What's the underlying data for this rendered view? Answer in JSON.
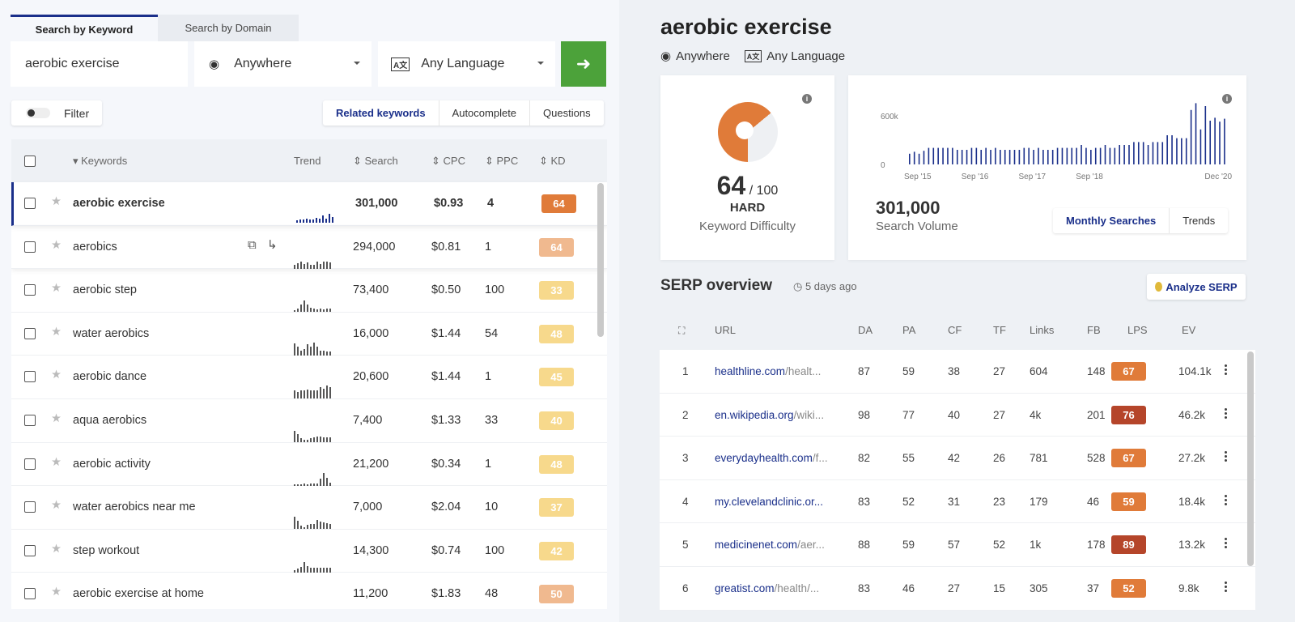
{
  "search": {
    "tabs": [
      "Search by Keyword",
      "Search by Domain"
    ],
    "keyword": "aerobic exercise",
    "location": "Anywhere",
    "language": "Any Language",
    "go_icon": "arrow-right-icon"
  },
  "filter": {
    "label": "Filter"
  },
  "modes": [
    "Related keywords",
    "Autocomplete",
    "Questions"
  ],
  "keywords_table": {
    "headers": {
      "keywords": "Keywords",
      "trend": "Trend",
      "search": "Search",
      "cpc": "CPC",
      "ppc": "PPC",
      "kd": "KD"
    },
    "rows": [
      {
        "keyword": "aerobic exercise",
        "search": "301,000",
        "cpc": "$0.93",
        "ppc": "4",
        "kd": "64",
        "kd_color": "#e07b39",
        "trend": [
          3,
          4,
          4,
          5,
          4,
          4,
          6,
          5,
          9,
          5,
          11,
          7
        ]
      },
      {
        "keyword": "aerobics",
        "search": "294,000",
        "cpc": "$0.81",
        "ppc": "1",
        "kd": "64",
        "kd_color": "#f0b98f",
        "trend": [
          5,
          7,
          9,
          6,
          8,
          5,
          5,
          9,
          6,
          9,
          9,
          8
        ]
      },
      {
        "keyword": "aerobic step",
        "search": "73,400",
        "cpc": "$0.50",
        "ppc": "100",
        "kd": "33",
        "kd_color": "#f7d98c",
        "trend": [
          2,
          4,
          9,
          14,
          9,
          5,
          4,
          3,
          4,
          3,
          4,
          4
        ]
      },
      {
        "keyword": "water aerobics",
        "search": "16,000",
        "cpc": "$1.44",
        "ppc": "54",
        "kd": "48",
        "kd_color": "#f7d98c",
        "trend": [
          15,
          11,
          6,
          8,
          14,
          11,
          16,
          11,
          6,
          6,
          5,
          5
        ]
      },
      {
        "keyword": "aerobic dance",
        "search": "20,600",
        "cpc": "$1.44",
        "ppc": "1",
        "kd": "45",
        "kd_color": "#f7d98c",
        "trend": [
          10,
          8,
          10,
          10,
          11,
          10,
          10,
          10,
          14,
          12,
          16,
          14
        ]
      },
      {
        "keyword": "aqua aerobics",
        "search": "7,400",
        "cpc": "$1.33",
        "ppc": "33",
        "kd": "40",
        "kd_color": "#f7d98c",
        "trend": [
          14,
          10,
          5,
          3,
          3,
          5,
          6,
          7,
          7,
          6,
          6,
          6
        ]
      },
      {
        "keyword": "aerobic activity",
        "search": "21,200",
        "cpc": "$0.34",
        "ppc": "1",
        "kd": "48",
        "kd_color": "#f7d98c",
        "trend": [
          2,
          2,
          2,
          3,
          2,
          3,
          3,
          3,
          9,
          16,
          10,
          4
        ]
      },
      {
        "keyword": "water aerobics near me",
        "search": "7,000",
        "cpc": "$2.04",
        "ppc": "10",
        "kd": "37",
        "kd_color": "#f7d98c",
        "trend": [
          15,
          10,
          4,
          2,
          5,
          6,
          6,
          11,
          9,
          8,
          7,
          6
        ]
      },
      {
        "keyword": "step workout",
        "search": "14,300",
        "cpc": "$0.74",
        "ppc": "100",
        "kd": "42",
        "kd_color": "#f7d98c",
        "trend": [
          3,
          5,
          7,
          13,
          8,
          6,
          6,
          6,
          6,
          6,
          6,
          6
        ]
      },
      {
        "keyword": "aerobic exercise at home",
        "search": "11,200",
        "cpc": "$1.83",
        "ppc": "48",
        "kd": "50",
        "kd_color": "#f0b98f",
        "trend": [
          1,
          1,
          2,
          1,
          3,
          1,
          2,
          1,
          2,
          3,
          1,
          2
        ]
      }
    ]
  },
  "detail": {
    "title": "aerobic exercise",
    "location": "Anywhere",
    "language": "Any Language",
    "kd": {
      "value": "64",
      "max": "/ 100",
      "level": "HARD",
      "label": "Keyword Difficulty",
      "fraction": 0.64,
      "color": "#e07b39"
    },
    "volume": {
      "value": "301,000",
      "label": "Search Volume",
      "tabs": [
        "Monthly Searches",
        "Trends"
      ]
    }
  },
  "chart_data": {
    "type": "bar",
    "ylim": [
      0,
      600000
    ],
    "yticks": [
      "0",
      "600k"
    ],
    "xticks": [
      "Sep '15",
      "Sep '16",
      "Sep '17",
      "Sep '18",
      "Dec '20"
    ],
    "grid": false,
    "color": "#1a2f8a",
    "values": [
      110000,
      130000,
      110000,
      140000,
      170000,
      170000,
      170000,
      170000,
      170000,
      170000,
      150000,
      150000,
      150000,
      170000,
      170000,
      150000,
      170000,
      150000,
      170000,
      150000,
      150000,
      150000,
      150000,
      150000,
      170000,
      170000,
      150000,
      170000,
      150000,
      150000,
      150000,
      170000,
      170000,
      170000,
      170000,
      170000,
      200000,
      170000,
      150000,
      170000,
      170000,
      200000,
      170000,
      170000,
      200000,
      200000,
      200000,
      230000,
      230000,
      230000,
      200000,
      230000,
      230000,
      230000,
      300000,
      300000,
      270000,
      270000,
      270000,
      560000,
      630000,
      360000,
      600000,
      450000,
      480000,
      440000,
      470000
    ]
  },
  "serp": {
    "title": "SERP overview",
    "updated": "5 days ago",
    "analyze_label": "Analyze SERP",
    "headers": [
      "URL",
      "DA",
      "PA",
      "CF",
      "TF",
      "Links",
      "FB",
      "LPS",
      "EV"
    ],
    "rows": [
      {
        "rank": "1",
        "domain": "healthline.com",
        "path": "/healt...",
        "da": "87",
        "pa": "59",
        "cf": "38",
        "tf": "27",
        "links": "604",
        "fb": "148",
        "lps": "67",
        "lps_color": "#e07b39",
        "ev": "104.1k"
      },
      {
        "rank": "2",
        "domain": "en.wikipedia.org",
        "path": "/wiki...",
        "da": "98",
        "pa": "77",
        "cf": "40",
        "tf": "27",
        "links": "4k",
        "fb": "201",
        "lps": "76",
        "lps_color": "#b5452a",
        "ev": "46.2k"
      },
      {
        "rank": "3",
        "domain": "everydayhealth.com",
        "path": "/f...",
        "da": "82",
        "pa": "55",
        "cf": "42",
        "tf": "26",
        "links": "781",
        "fb": "528",
        "lps": "67",
        "lps_color": "#e07b39",
        "ev": "27.2k"
      },
      {
        "rank": "4",
        "domain": "my.clevelandclinic.or...",
        "path": "",
        "da": "83",
        "pa": "52",
        "cf": "31",
        "tf": "23",
        "links": "179",
        "fb": "46",
        "lps": "59",
        "lps_color": "#e07b39",
        "ev": "18.4k"
      },
      {
        "rank": "5",
        "domain": "medicinenet.com",
        "path": "/aer...",
        "da": "88",
        "pa": "59",
        "cf": "57",
        "tf": "52",
        "links": "1k",
        "fb": "178",
        "lps": "89",
        "lps_color": "#b5452a",
        "ev": "13.2k"
      },
      {
        "rank": "6",
        "domain": "greatist.com",
        "path": "/health/...",
        "da": "83",
        "pa": "46",
        "cf": "27",
        "tf": "15",
        "links": "305",
        "fb": "37",
        "lps": "52",
        "lps_color": "#e07b39",
        "ev": "9.8k"
      }
    ]
  }
}
